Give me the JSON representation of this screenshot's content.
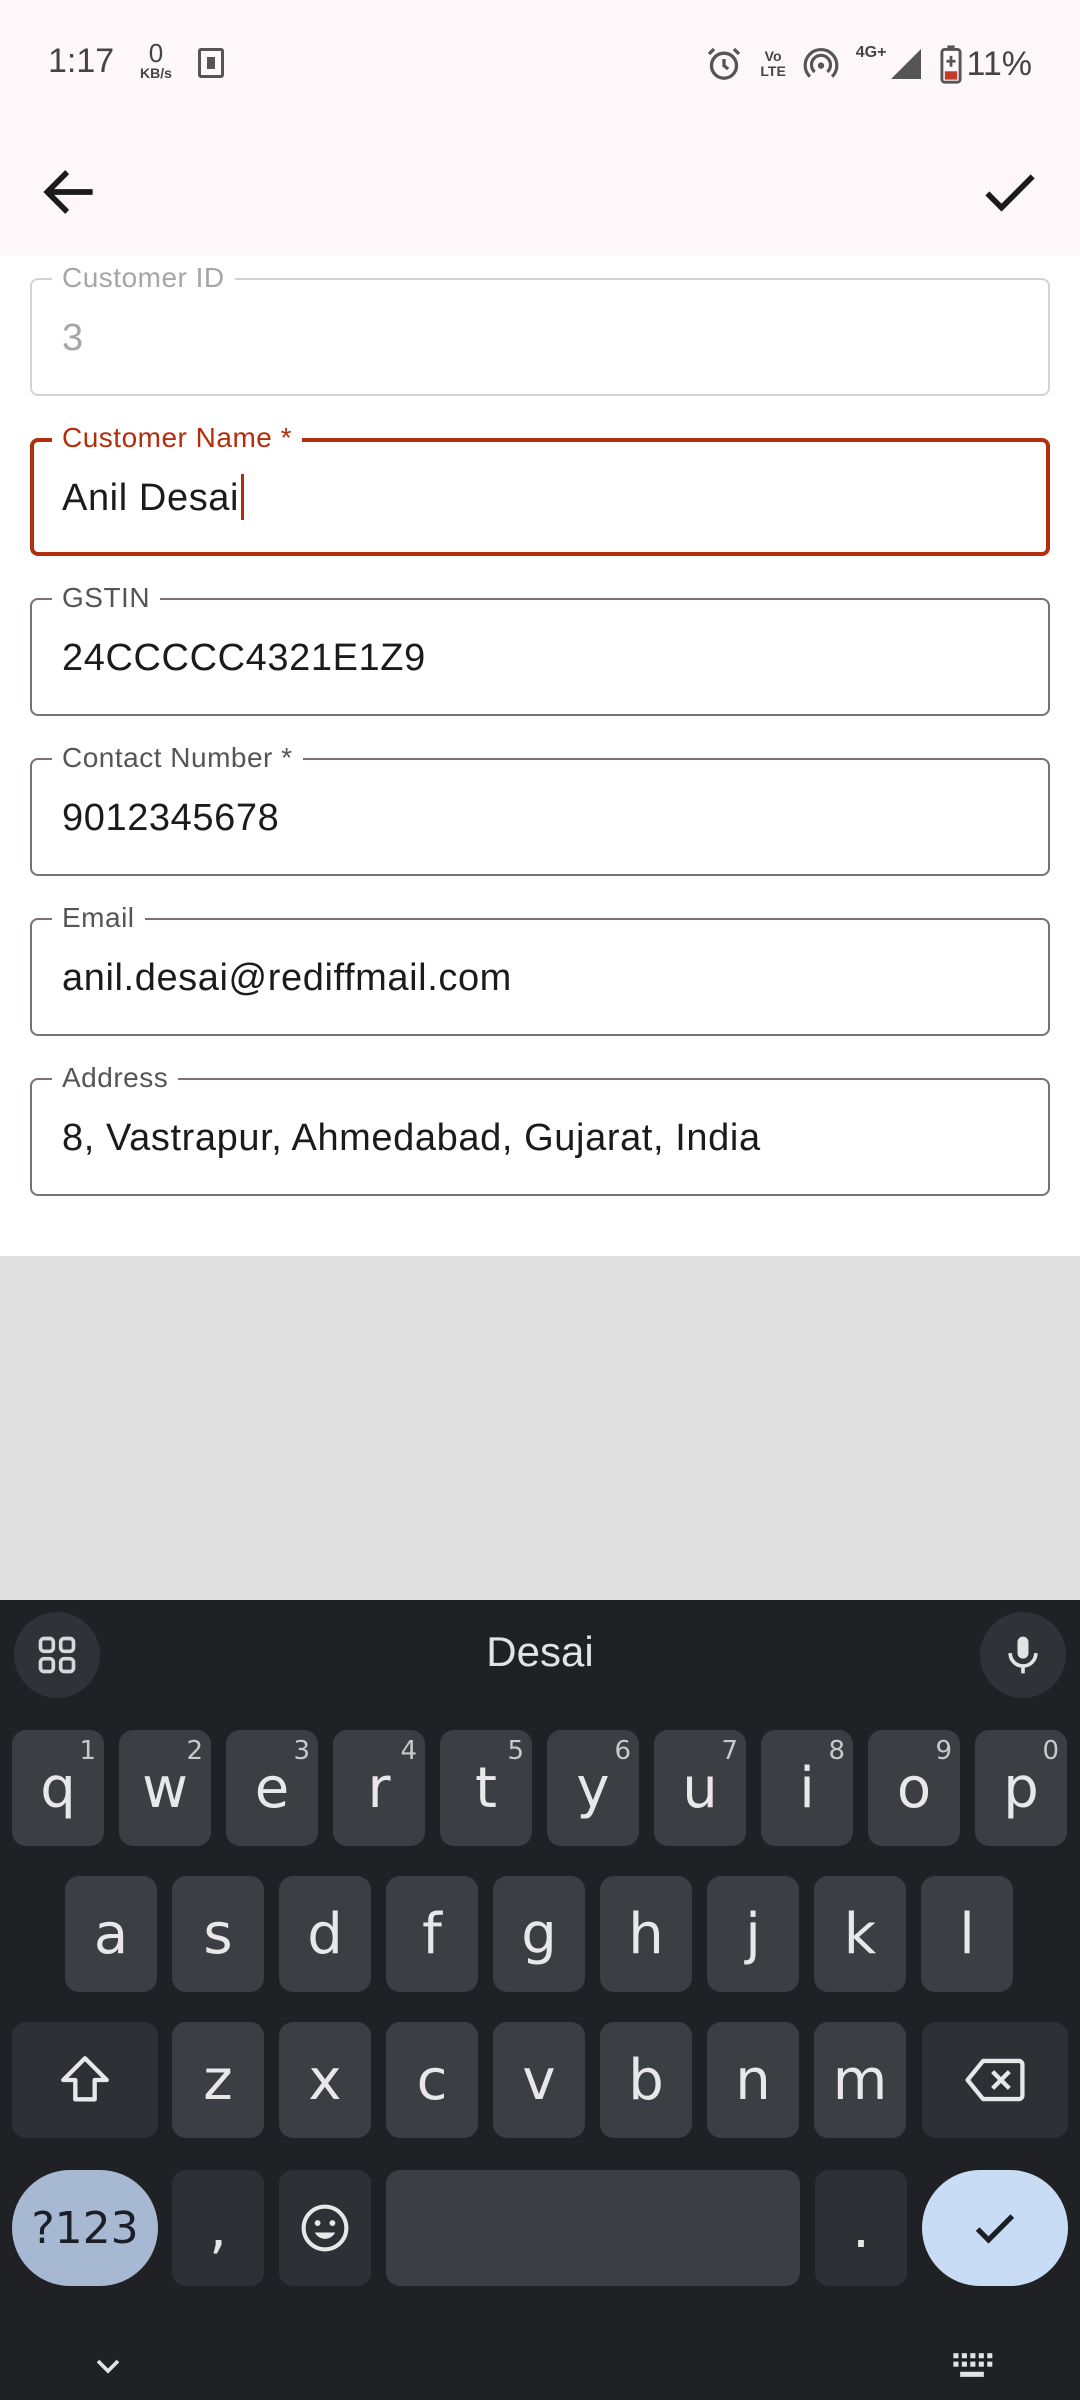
{
  "status_bar": {
    "time": "1:17",
    "net_speed_value": "0",
    "net_speed_unit": "KB/s",
    "volte_line1": "Vo",
    "volte_line2": "LTE",
    "network": "4G+",
    "battery": "11%"
  },
  "app_bar": {
    "back_icon": "arrow-back-icon",
    "confirm_icon": "check-icon"
  },
  "form": {
    "customer_id": {
      "label": "Customer ID",
      "value": "3"
    },
    "customer_name": {
      "label": "Customer Name *",
      "value": "Anil Desai"
    },
    "gstin": {
      "label": "GSTIN",
      "value": "24CCCCC4321E1Z9"
    },
    "contact_number": {
      "label": "Contact Number *",
      "value": "9012345678"
    },
    "email": {
      "label": "Email",
      "value": "anil.desai@rediffmail.com"
    },
    "address": {
      "label": "Address",
      "value": "8, Vastrapur, Ahmedabad, Gujarat, India"
    }
  },
  "keyboard": {
    "suggestion": "Desai",
    "row1": [
      {
        "key": "q",
        "hint": "1"
      },
      {
        "key": "w",
        "hint": "2"
      },
      {
        "key": "e",
        "hint": "3"
      },
      {
        "key": "r",
        "hint": "4"
      },
      {
        "key": "t",
        "hint": "5"
      },
      {
        "key": "y",
        "hint": "6"
      },
      {
        "key": "u",
        "hint": "7"
      },
      {
        "key": "i",
        "hint": "8"
      },
      {
        "key": "o",
        "hint": "9"
      },
      {
        "key": "p",
        "hint": "0"
      }
    ],
    "row2": [
      "a",
      "s",
      "d",
      "f",
      "g",
      "h",
      "j",
      "k",
      "l"
    ],
    "row3": [
      "z",
      "x",
      "c",
      "v",
      "b",
      "n",
      "m"
    ],
    "symbols_label": "?123",
    "comma": ",",
    "period": "."
  },
  "colors": {
    "accent": "#b22e0c",
    "appbar_bg": "#fdf7fa",
    "keyboard_bg": "#1f2125",
    "enter_key": "#c9dcf5"
  }
}
